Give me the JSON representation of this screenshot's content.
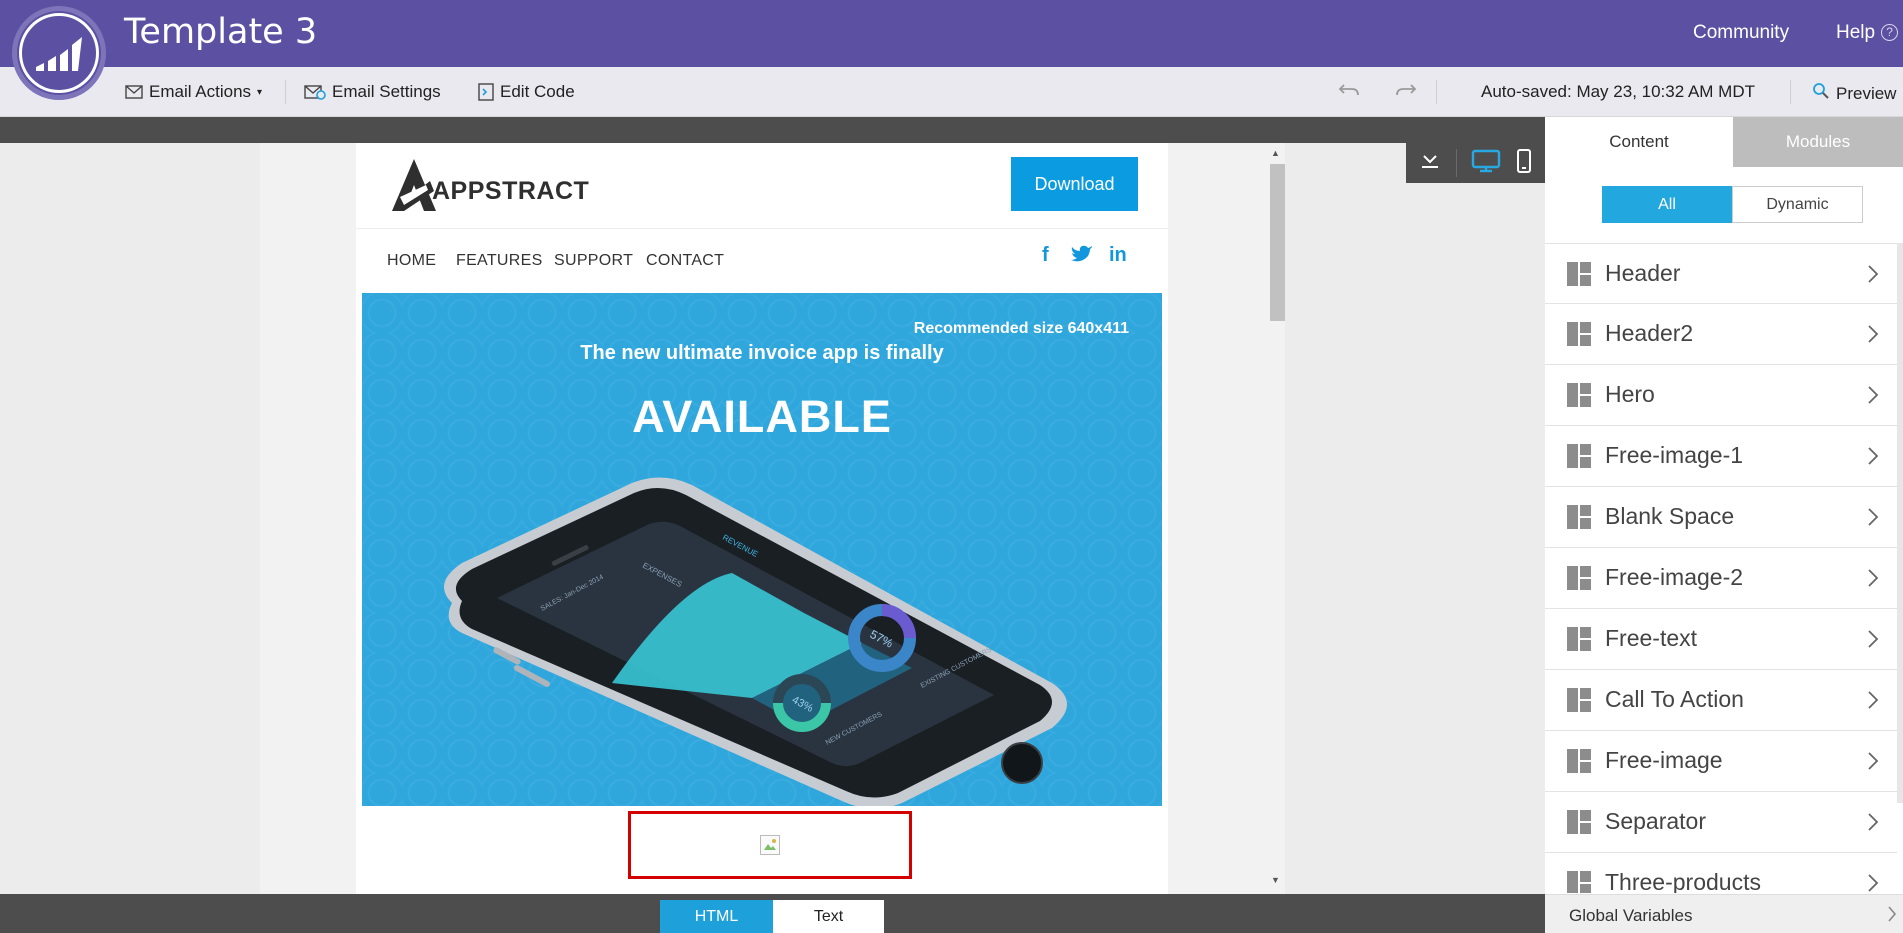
{
  "app": {
    "title": "Template 3",
    "community_label": "Community",
    "help_label": "Help",
    "help_glyph": "?"
  },
  "toolbar": {
    "email_actions_label": "Email Actions",
    "email_settings_label": "Email Settings",
    "edit_code_label": "Edit Code",
    "autosave_text": "Auto-saved: May 23, 10:32 AM MDT",
    "preview_label": "Preview"
  },
  "email": {
    "brand_name": "APPSTRACT",
    "download_label": "Download",
    "nav": [
      "HOME",
      "FEATURES",
      "SUPPORT",
      "CONTACT"
    ],
    "social": [
      "f",
      "twitter",
      "in"
    ],
    "hero": {
      "recommended_size": "Recommended size 640x411",
      "subtitle": "The new ultimate invoice app is finally",
      "headline": "AVAILABLE"
    },
    "phone_screen": {
      "tabs": [
        "EXPENSES",
        "REVENUE"
      ],
      "sales_label": "SALES: Jan-Dec 2014",
      "stat_1": "57%",
      "stat_1_label": "EXISTING CUSTOMERS",
      "stat_2": "43%",
      "stat_2_label": "NEW CUSTOMERS"
    }
  },
  "bottom_tabs": {
    "html_label": "HTML",
    "text_label": "Text"
  },
  "panel": {
    "tab_content": "Content",
    "tab_modules": "Modules",
    "filter_all": "All",
    "filter_dynamic": "Dynamic",
    "items": [
      {
        "label": "Header"
      },
      {
        "label": "Header2"
      },
      {
        "label": "Hero"
      },
      {
        "label": "Free-image-1"
      },
      {
        "label": "Blank Space"
      },
      {
        "label": "Free-image-2"
      },
      {
        "label": "Free-text"
      },
      {
        "label": "Call To Action"
      },
      {
        "label": "Free-image"
      },
      {
        "label": "Separator"
      },
      {
        "label": "Three-products"
      }
    ],
    "global_variables_label": "Global Variables"
  },
  "colors": {
    "brand_purple": "#5b50a2",
    "accent_blue": "#1ea0db",
    "hero_blue": "#2fa7dd",
    "selection_red": "#d40000"
  }
}
